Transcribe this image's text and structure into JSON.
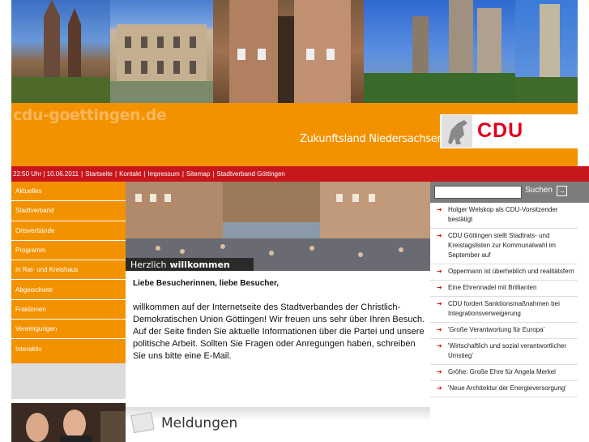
{
  "header": {
    "site_name": "cdu-goettingen.de",
    "slogan": "Zukunftsland Niedersachsen.",
    "logo_text": "CDU"
  },
  "topbar": {
    "datetime": "22:50 Uhr | 10.06.2011",
    "links": [
      "Startseite",
      "Kontakt",
      "Impressum",
      "Sitemap",
      "Stadtverband Göttingen"
    ]
  },
  "sidebar": {
    "items": [
      "Aktuelles",
      "Stadtverband",
      "Ortsverbände",
      "Programm",
      "In Rat- und Kreishaus",
      "Abgeordnete",
      "Fraktionen",
      "Vereinigungen",
      "Interaktiv"
    ]
  },
  "welcome": {
    "prefix": "Herzlich",
    "bold": "willkommen"
  },
  "content": {
    "greeting": "Liebe Besucherinnen, liebe Besucher,",
    "p1": "willkommen auf der Internetseite des Stadtverbandes der Christlich-Demokratischen Union Göttingen! Wir freuen uns sehr über Ihren Besuch.",
    "p2": "Auf der Seite finden Sie aktuelle Informationen über die Partei und unsere politische Arbeit. Sollten Sie Fragen oder Anregungen haben, schreiben Sie uns bitte eine E-Mail."
  },
  "meldungen": {
    "title": "Meldungen"
  },
  "search": {
    "label": "Suchen",
    "value": ""
  },
  "news": [
    "Holger Welskop als CDU-Vorsitzender bestätigt",
    "CDU Göttingen stellt Stadtrats- und Kreistagslisten zur Kommunalwahl im September auf",
    "Oppermann ist überheblich und realitätsfern",
    "Eine Ehrennadel mit Brillianten",
    "CDU fordert Sanktionsmaßnahmen bei Integrationsverweigerung",
    "'Große Verantwortung für Europa'",
    "'Wirtschaftlich und sozial verantwortlicher Umstieg'",
    "Gröhe: Große Ehre für Angela Merkel",
    "'Neue Architektur der Energieversorgung'"
  ],
  "colors": {
    "orange": "#f39200",
    "red": "#c8161d",
    "grey": "#7d7d7d"
  }
}
